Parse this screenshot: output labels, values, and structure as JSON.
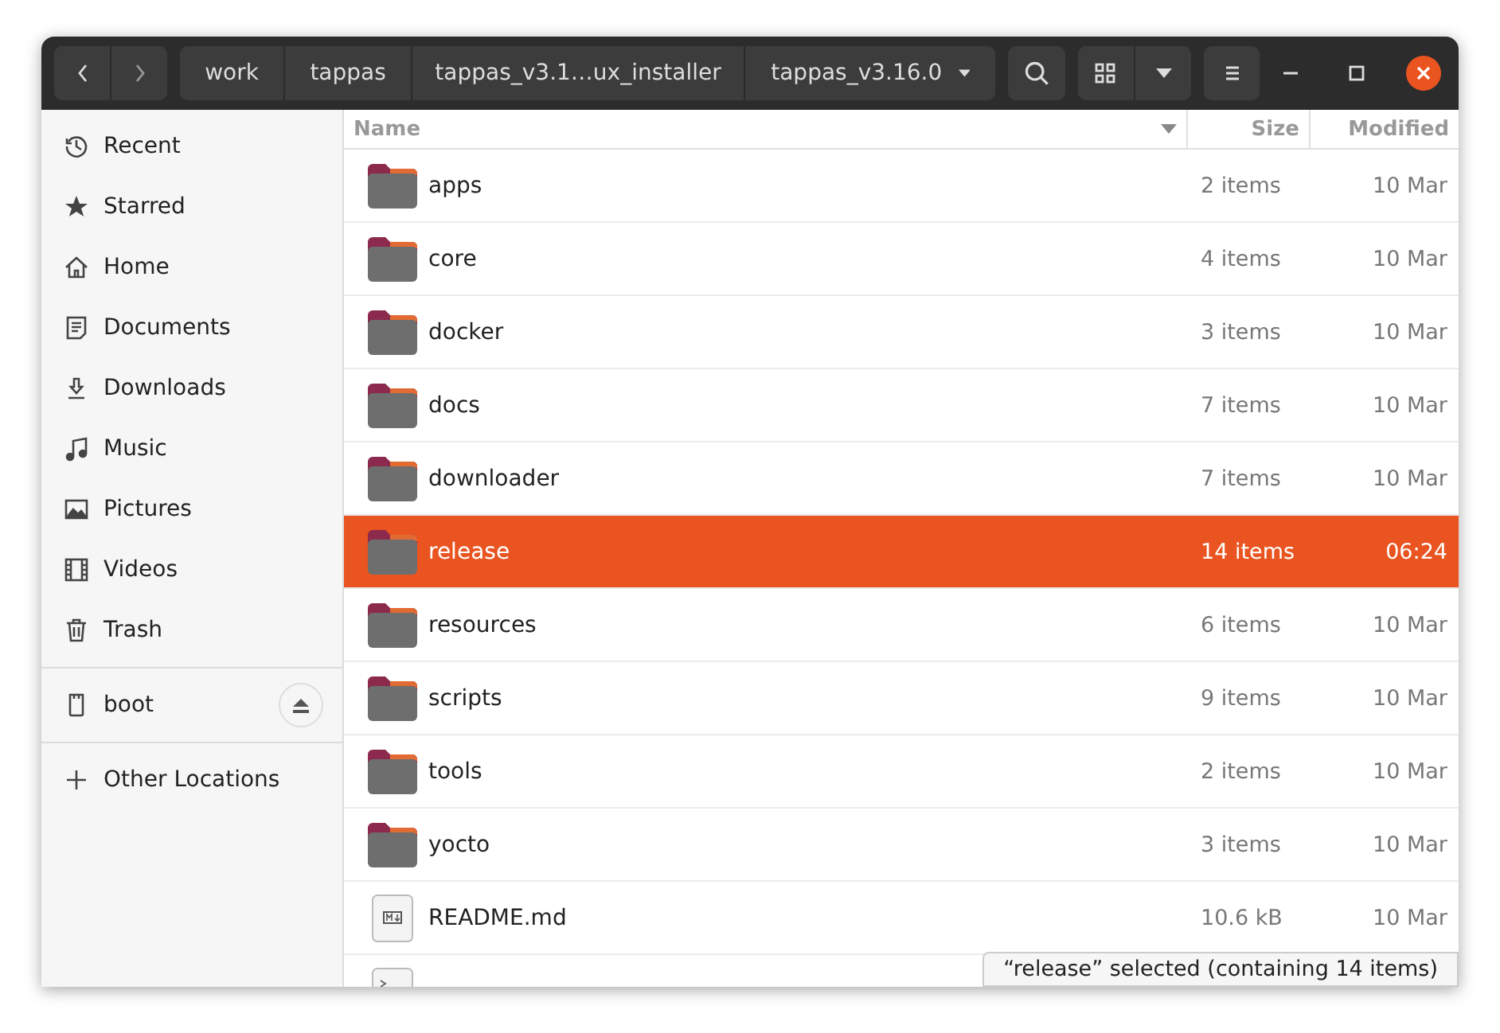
{
  "toolbar": {
    "path": [
      {
        "label": "work",
        "dropdown": false
      },
      {
        "label": "tappas",
        "dropdown": false
      },
      {
        "label": "tappas_v3.1…ux_installer",
        "dropdown": false
      },
      {
        "label": "tappas_v3.16.0",
        "dropdown": true
      }
    ]
  },
  "sidebar": {
    "items": [
      {
        "kind": "recent",
        "label": "Recent"
      },
      {
        "kind": "starred",
        "label": "Starred"
      },
      {
        "kind": "home",
        "label": "Home"
      },
      {
        "kind": "documents",
        "label": "Documents"
      },
      {
        "kind": "downloads",
        "label": "Downloads"
      },
      {
        "kind": "music",
        "label": "Music"
      },
      {
        "kind": "pictures",
        "label": "Pictures"
      },
      {
        "kind": "videos",
        "label": "Videos"
      },
      {
        "kind": "trash",
        "label": "Trash"
      },
      {
        "kind": "drive",
        "label": "boot"
      },
      {
        "kind": "other",
        "label": "Other Locations"
      }
    ]
  },
  "table": {
    "columns": [
      "Name",
      "Size",
      "Modified"
    ],
    "rows": [
      {
        "kind": "folder",
        "name": "apps",
        "size": "2 items",
        "modified": "10 Mar",
        "selected": false
      },
      {
        "kind": "folder",
        "name": "core",
        "size": "4 items",
        "modified": "10 Mar",
        "selected": false
      },
      {
        "kind": "folder",
        "name": "docker",
        "size": "3 items",
        "modified": "10 Mar",
        "selected": false
      },
      {
        "kind": "folder",
        "name": "docs",
        "size": "7 items",
        "modified": "10 Mar",
        "selected": false
      },
      {
        "kind": "folder",
        "name": "downloader",
        "size": "7 items",
        "modified": "10 Mar",
        "selected": false
      },
      {
        "kind": "folder",
        "name": "release",
        "size": "14 items",
        "modified": "06:24",
        "selected": true
      },
      {
        "kind": "folder",
        "name": "resources",
        "size": "6 items",
        "modified": "10 Mar",
        "selected": false
      },
      {
        "kind": "folder",
        "name": "scripts",
        "size": "9 items",
        "modified": "10 Mar",
        "selected": false
      },
      {
        "kind": "folder",
        "name": "tools",
        "size": "2 items",
        "modified": "10 Mar",
        "selected": false
      },
      {
        "kind": "folder",
        "name": "yocto",
        "size": "3 items",
        "modified": "10 Mar",
        "selected": false
      },
      {
        "kind": "markdown",
        "name": "README.md",
        "size": "10.6 kB",
        "modified": "10 Mar",
        "selected": false
      }
    ],
    "cut_row": {
      "kind": "script"
    }
  },
  "status_bar": {
    "text": "“release” selected  (containing 14 items)"
  }
}
